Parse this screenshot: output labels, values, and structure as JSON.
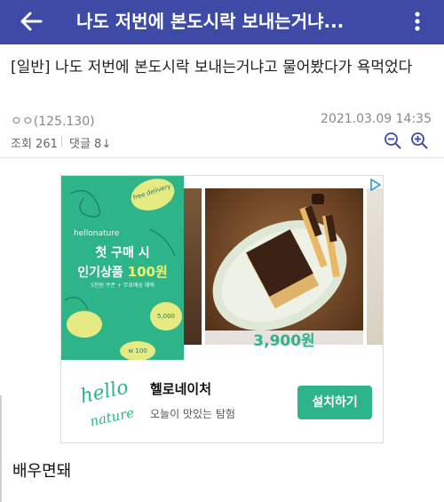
{
  "appbar": {
    "title": "나도 저번에 본도시락 보내는거냐...",
    "color": "#3d4aa6"
  },
  "post": {
    "title": "[일반] 나도 저번에 본도시락 보내는거냐고 물어봤다가 욕먹었다",
    "author": "ㅇㅇ(125.130)",
    "date": "2021.03.09 14:35",
    "views": "조회 261",
    "comments": "댓글 8↓",
    "body": "배우면돼"
  },
  "ad": {
    "banner": {
      "free_badge": "free delivery",
      "brand": "hellonature",
      "line1": "첫 구매 시",
      "line2_prefix": "인기상품 ",
      "line2_price": "100원",
      "fine_print": "5천원 쿠폰 + 무료배송 혜택",
      "coin1": "5,000",
      "coin2": "w 100"
    },
    "photo_price": "3,900원",
    "advertiser_name": "헬로네이처",
    "advertiser_desc": "오늘이 맛있는 탐험",
    "install_label": "설치하기",
    "accent_color": "#2db589"
  },
  "icons": {
    "back": "back-arrow-icon",
    "menu": "kebab-menu-icon",
    "zoom_out": "zoom-out-icon",
    "zoom_in": "zoom-in-icon",
    "ad_choices": "adchoices-icon"
  }
}
